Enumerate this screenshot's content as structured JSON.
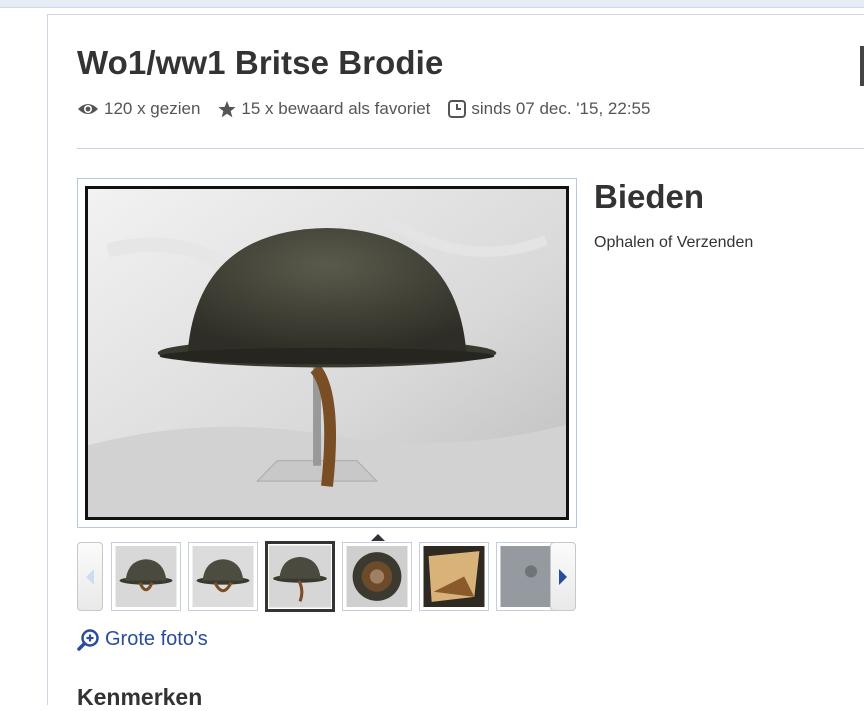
{
  "listing": {
    "title": "Wo1/ww1 Britse Brodie",
    "views": "120 x gezien",
    "favorites": "15 x bewaard als favoriet",
    "since": "sinds 07 dec. '15, 22:55"
  },
  "gallery": {
    "large_photos_link": "Grote foto's",
    "thumb_count": 6,
    "selected_thumb": 3
  },
  "bid": {
    "title": "Bieden",
    "delivery": "Ophalen of Verzenden"
  },
  "sections": {
    "features_title": "Kenmerken"
  },
  "colors": {
    "link": "#2a4d9b",
    "text": "#333333",
    "border": "#b9c7de"
  },
  "icons": [
    "eye-icon",
    "star-icon",
    "clock-icon",
    "zoom-in-icon",
    "chevron-left-icon",
    "chevron-right-icon"
  ]
}
